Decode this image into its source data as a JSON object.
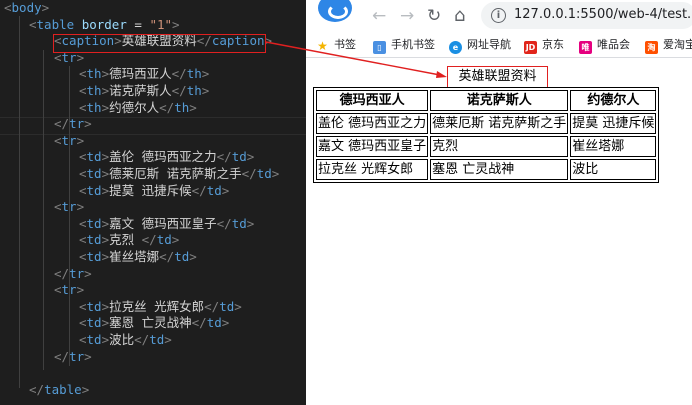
{
  "editor": {
    "lines": [
      {
        "indent": 0,
        "parts": [
          [
            "brk",
            "<"
          ],
          [
            "tag",
            "body"
          ],
          [
            "brk",
            ">"
          ]
        ]
      },
      {
        "indent": 1,
        "parts": [
          [
            "brk",
            "<"
          ],
          [
            "tag",
            "table"
          ],
          [
            "txt",
            " "
          ],
          [
            "attr",
            "border"
          ],
          [
            "txt",
            " = "
          ],
          [
            "str",
            "\"1\""
          ],
          [
            "brk",
            ">"
          ]
        ]
      },
      {
        "indent": 2,
        "parts": [
          [
            "brk",
            "<"
          ],
          [
            "tag",
            "caption"
          ],
          [
            "brk",
            ">"
          ],
          [
            "txt",
            "英雄联盟资料"
          ],
          [
            "brk",
            "</"
          ],
          [
            "tag",
            "caption"
          ],
          [
            "brk",
            ">"
          ]
        ]
      },
      {
        "indent": 2,
        "parts": [
          [
            "brk",
            "<"
          ],
          [
            "tag",
            "tr"
          ],
          [
            "brk",
            ">"
          ]
        ]
      },
      {
        "indent": 3,
        "parts": [
          [
            "brk",
            "<"
          ],
          [
            "tag",
            "th"
          ],
          [
            "brk",
            ">"
          ],
          [
            "txt",
            "德玛西亚人"
          ],
          [
            "brk",
            "</"
          ],
          [
            "tag",
            "th"
          ],
          [
            "brk",
            ">"
          ]
        ]
      },
      {
        "indent": 3,
        "parts": [
          [
            "brk",
            "<"
          ],
          [
            "tag",
            "th"
          ],
          [
            "brk",
            ">"
          ],
          [
            "txt",
            "诺克萨斯人"
          ],
          [
            "brk",
            "</"
          ],
          [
            "tag",
            "th"
          ],
          [
            "brk",
            ">"
          ]
        ]
      },
      {
        "indent": 3,
        "parts": [
          [
            "brk",
            "<"
          ],
          [
            "tag",
            "th"
          ],
          [
            "brk",
            ">"
          ],
          [
            "txt",
            "约德尔人"
          ],
          [
            "brk",
            "</"
          ],
          [
            "tag",
            "th"
          ],
          [
            "brk",
            ">"
          ]
        ]
      },
      {
        "indent": 2,
        "parts": [
          [
            "brk",
            "</"
          ],
          [
            "tag",
            "tr"
          ],
          [
            "brk",
            ">"
          ]
        ]
      },
      {
        "indent": 2,
        "parts": [
          [
            "brk",
            "<"
          ],
          [
            "tag",
            "tr"
          ],
          [
            "brk",
            ">"
          ]
        ]
      },
      {
        "indent": 3,
        "parts": [
          [
            "brk",
            "<"
          ],
          [
            "tag",
            "td"
          ],
          [
            "brk",
            ">"
          ],
          [
            "txt",
            "盖伦 德玛西亚之力"
          ],
          [
            "brk",
            "</"
          ],
          [
            "tag",
            "td"
          ],
          [
            "brk",
            ">"
          ]
        ]
      },
      {
        "indent": 3,
        "parts": [
          [
            "brk",
            "<"
          ],
          [
            "tag",
            "td"
          ],
          [
            "brk",
            ">"
          ],
          [
            "txt",
            "德莱厄斯 诺克萨斯之手"
          ],
          [
            "brk",
            "</"
          ],
          [
            "tag",
            "td"
          ],
          [
            "brk",
            ">"
          ]
        ]
      },
      {
        "indent": 3,
        "parts": [
          [
            "brk",
            "<"
          ],
          [
            "tag",
            "td"
          ],
          [
            "brk",
            ">"
          ],
          [
            "txt",
            "提莫 迅捷斥候"
          ],
          [
            "brk",
            "</"
          ],
          [
            "tag",
            "td"
          ],
          [
            "brk",
            ">"
          ]
        ]
      },
      {
        "indent": 2,
        "parts": [
          [
            "brk",
            "<"
          ],
          [
            "tag",
            "tr"
          ],
          [
            "brk",
            ">"
          ]
        ]
      },
      {
        "indent": 3,
        "parts": [
          [
            "brk",
            "<"
          ],
          [
            "tag",
            "td"
          ],
          [
            "brk",
            ">"
          ],
          [
            "txt",
            "嘉文 德玛西亚皇子"
          ],
          [
            "brk",
            "</"
          ],
          [
            "tag",
            "td"
          ],
          [
            "brk",
            ">"
          ]
        ]
      },
      {
        "indent": 3,
        "parts": [
          [
            "brk",
            "<"
          ],
          [
            "tag",
            "td"
          ],
          [
            "brk",
            ">"
          ],
          [
            "txt",
            "克烈 "
          ],
          [
            "brk",
            "</"
          ],
          [
            "tag",
            "td"
          ],
          [
            "brk",
            ">"
          ]
        ]
      },
      {
        "indent": 3,
        "parts": [
          [
            "brk",
            "<"
          ],
          [
            "tag",
            "td"
          ],
          [
            "brk",
            ">"
          ],
          [
            "txt",
            "崔丝塔娜"
          ],
          [
            "brk",
            "</"
          ],
          [
            "tag",
            "td"
          ],
          [
            "brk",
            ">"
          ]
        ]
      },
      {
        "indent": 2,
        "parts": [
          [
            "brk",
            "</"
          ],
          [
            "tag",
            "tr"
          ],
          [
            "brk",
            ">"
          ]
        ]
      },
      {
        "indent": 2,
        "parts": [
          [
            "brk",
            "<"
          ],
          [
            "tag",
            "tr"
          ],
          [
            "brk",
            ">"
          ]
        ]
      },
      {
        "indent": 3,
        "parts": [
          [
            "brk",
            "<"
          ],
          [
            "tag",
            "td"
          ],
          [
            "brk",
            ">"
          ],
          [
            "txt",
            "拉克丝 光辉女郎"
          ],
          [
            "brk",
            "</"
          ],
          [
            "tag",
            "td"
          ],
          [
            "brk",
            ">"
          ]
        ]
      },
      {
        "indent": 3,
        "parts": [
          [
            "brk",
            "<"
          ],
          [
            "tag",
            "td"
          ],
          [
            "brk",
            ">"
          ],
          [
            "txt",
            "塞恩 亡灵战神"
          ],
          [
            "brk",
            "</"
          ],
          [
            "tag",
            "td"
          ],
          [
            "brk",
            ">"
          ]
        ]
      },
      {
        "indent": 3,
        "parts": [
          [
            "brk",
            "<"
          ],
          [
            "tag",
            "td"
          ],
          [
            "brk",
            ">"
          ],
          [
            "txt",
            "波比"
          ],
          [
            "brk",
            "</"
          ],
          [
            "tag",
            "td"
          ],
          [
            "brk",
            ">"
          ]
        ]
      },
      {
        "indent": 2,
        "parts": [
          [
            "brk",
            "</"
          ],
          [
            "tag",
            "tr"
          ],
          [
            "brk",
            ">"
          ]
        ]
      },
      {
        "indent": 0,
        "parts": []
      },
      {
        "indent": 1,
        "parts": [
          [
            "brk",
            "</"
          ],
          [
            "tag",
            "table"
          ],
          [
            "brk",
            ">"
          ]
        ]
      }
    ]
  },
  "browser": {
    "logo_icon": "browser-logo-icon",
    "nav": {
      "back": "←",
      "forward": "→",
      "reload": "↻",
      "home": "⌂"
    },
    "info_icon": "i",
    "url": "127.0.0.1:5500/web-4/test...",
    "bookmarks": [
      {
        "label": "书签",
        "icon": "star-icon",
        "color": "#f4b400",
        "glyph": "★"
      },
      {
        "label": "手机书签",
        "icon": "phone-bookmark-icon",
        "color": "#4a90e2",
        "glyph": "▯"
      },
      {
        "label": "网址导航",
        "icon": "nav-e-icon",
        "color": "#1a8fe3",
        "glyph": "e"
      },
      {
        "label": "京东",
        "icon": "jd-icon",
        "color": "#e1251b",
        "glyph": "JD"
      },
      {
        "label": "唯品会",
        "icon": "vip-icon",
        "color": "#e5007f",
        "glyph": "唯"
      },
      {
        "label": "爱淘宝",
        "icon": "taobao-icon",
        "color": "#ff5000",
        "glyph": "淘"
      }
    ]
  },
  "page": {
    "caption": "英雄联盟资料",
    "headers": [
      "德玛西亚人",
      "诺克萨斯人",
      "约德尔人"
    ],
    "rows": [
      [
        "盖伦 德玛西亚之力",
        "德莱厄斯 诺克萨斯之手",
        "提莫 迅捷斥候"
      ],
      [
        "嘉文 德玛西亚皇子",
        "克烈",
        "崔丝塔娜"
      ],
      [
        "拉克丝 光辉女郎",
        "塞恩 亡灵战神",
        "波比"
      ]
    ]
  },
  "colors": {
    "annotation": "#e02020"
  }
}
